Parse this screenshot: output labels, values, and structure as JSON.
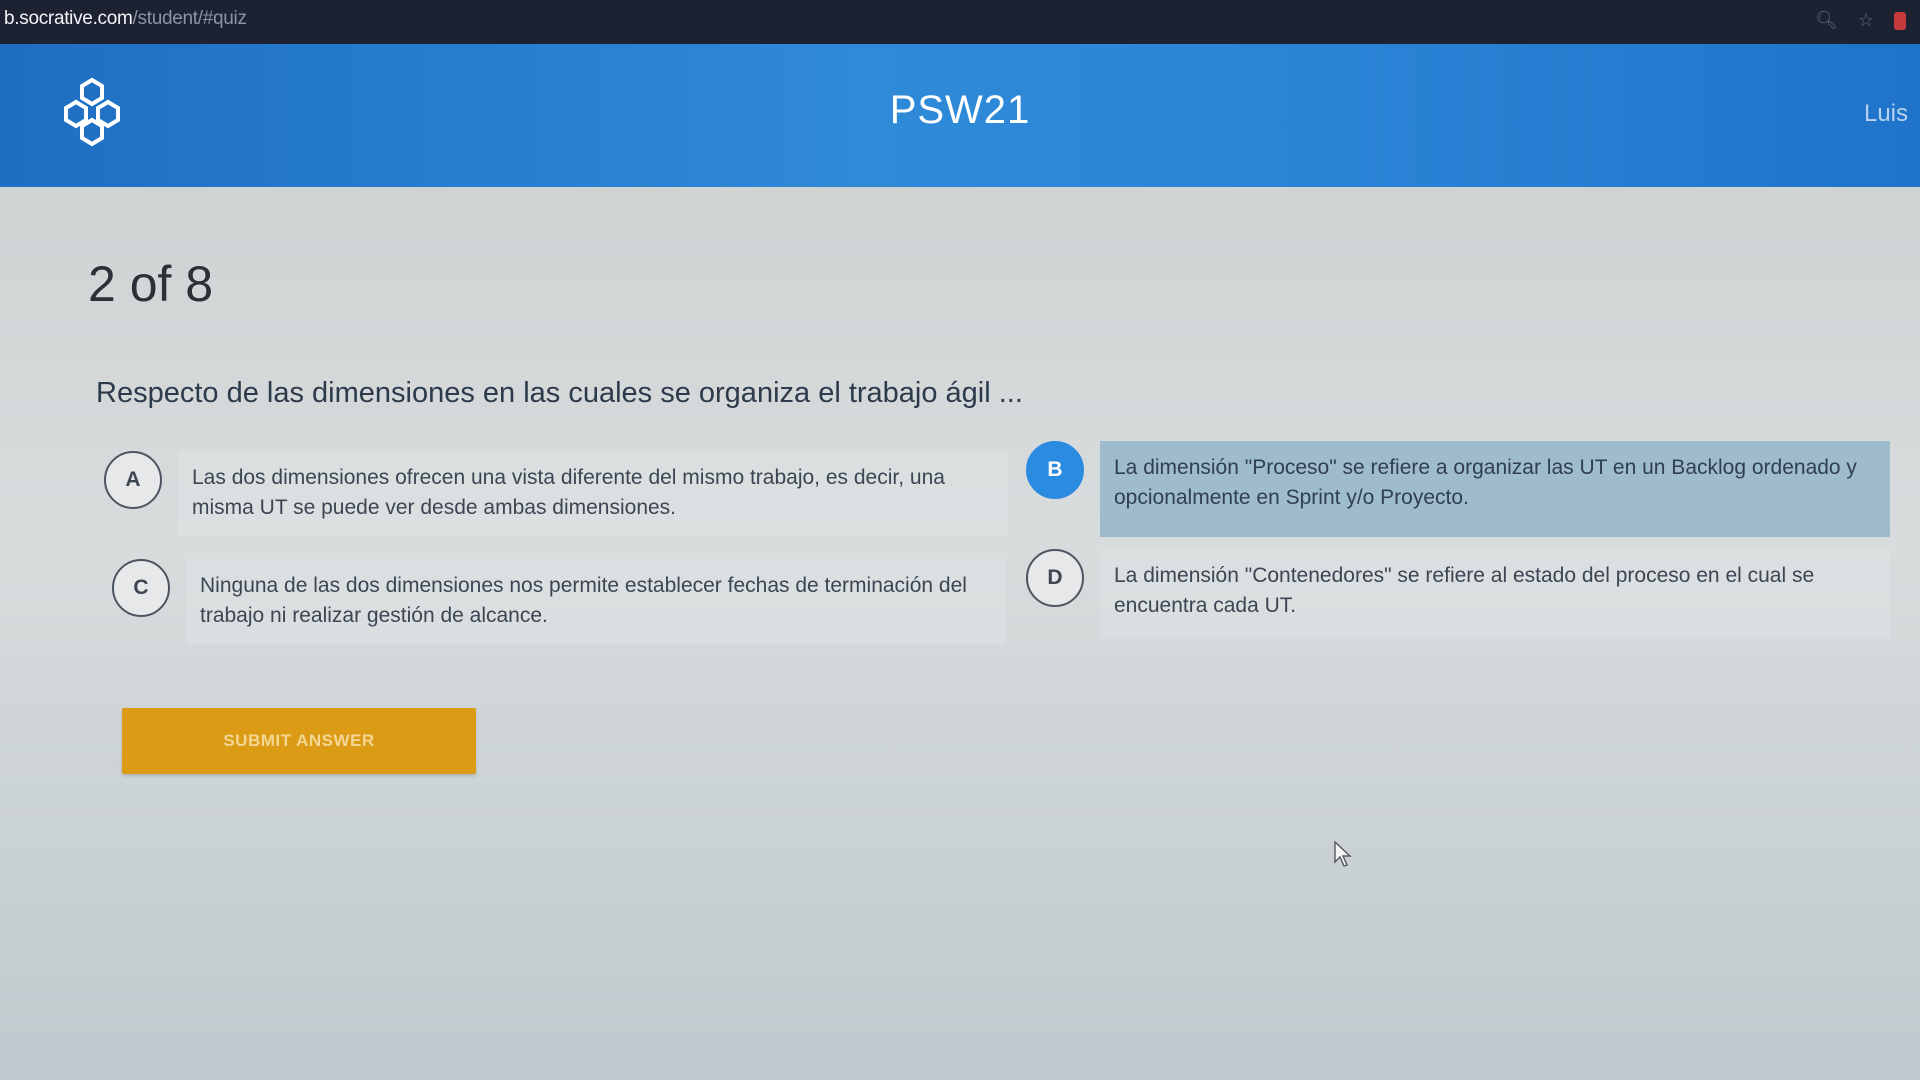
{
  "browser": {
    "url_host": "b.socrative.com",
    "url_path": "/student/#quiz"
  },
  "header": {
    "room_name": "PSW21",
    "user_name": "Luis",
    "logo_icon": "socrative-logo-icon"
  },
  "quiz": {
    "progress": "2 of 8",
    "question": "Respecto de las dimensiones en las cuales se organiza el trabajo ágil ...",
    "answers": [
      {
        "letter": "A",
        "text": "Las dos dimensiones ofrecen una vista diferente del mismo trabajo, es decir, una misma UT se puede ver desde ambas dimensiones.",
        "selected": false
      },
      {
        "letter": "B",
        "text": "La dimensión \"Proceso\" se refiere a organizar las UT en un Backlog ordenado y opcionalmente en Sprint y/o Proyecto.",
        "selected": true
      },
      {
        "letter": "C",
        "text": "Ninguna de las dos dimensiones nos permite establecer fechas de terminación del trabajo ni realizar gestión de alcance.",
        "selected": false
      },
      {
        "letter": "D",
        "text": "La dimensión \"Contenedores\" se refiere al estado del proceso en el cual se encuentra cada UT.",
        "selected": false
      }
    ],
    "submit_label": "SUBMIT ANSWER"
  },
  "colors": {
    "header_blue": "#2f8ad8",
    "selected_blue": "#2b8be0",
    "selected_answer_bg": "#9fbccc",
    "submit_orange": "#dc9b15"
  }
}
